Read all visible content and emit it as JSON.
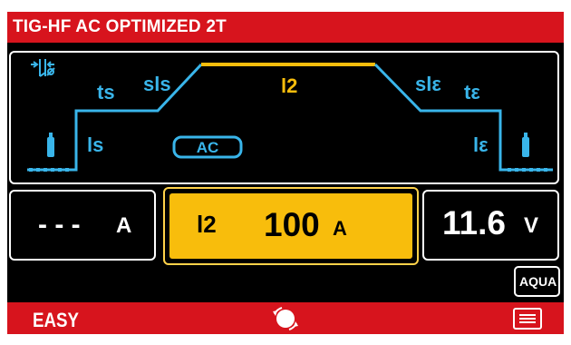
{
  "title": "TIG-HF AC OPTIMIZED 2T",
  "graph": {
    "hf_icon": "hf-start-icon",
    "gas_icon": "gas-cylinder-icon",
    "labels": {
      "ts": "ts",
      "sls": "sls",
      "ls": "ls",
      "l2": "l2",
      "sle": "slε",
      "te": "tε",
      "le": "lε"
    },
    "mode_badge": "AC"
  },
  "readouts": {
    "left_value": "- - -",
    "left_unit": "A",
    "mid_label": "l2",
    "mid_value": "100",
    "mid_unit": "A",
    "right_value": "11.6",
    "right_unit": "V"
  },
  "aqua_button": "AQUA",
  "bottom": {
    "easy": "EASY",
    "encoder_icon": "rotary-knob-icon",
    "menu_icon": "menu-list-icon"
  },
  "colors": {
    "brand_red": "#d7141d",
    "cyan": "#39b5ea",
    "yellow": "#f8bd0c"
  }
}
